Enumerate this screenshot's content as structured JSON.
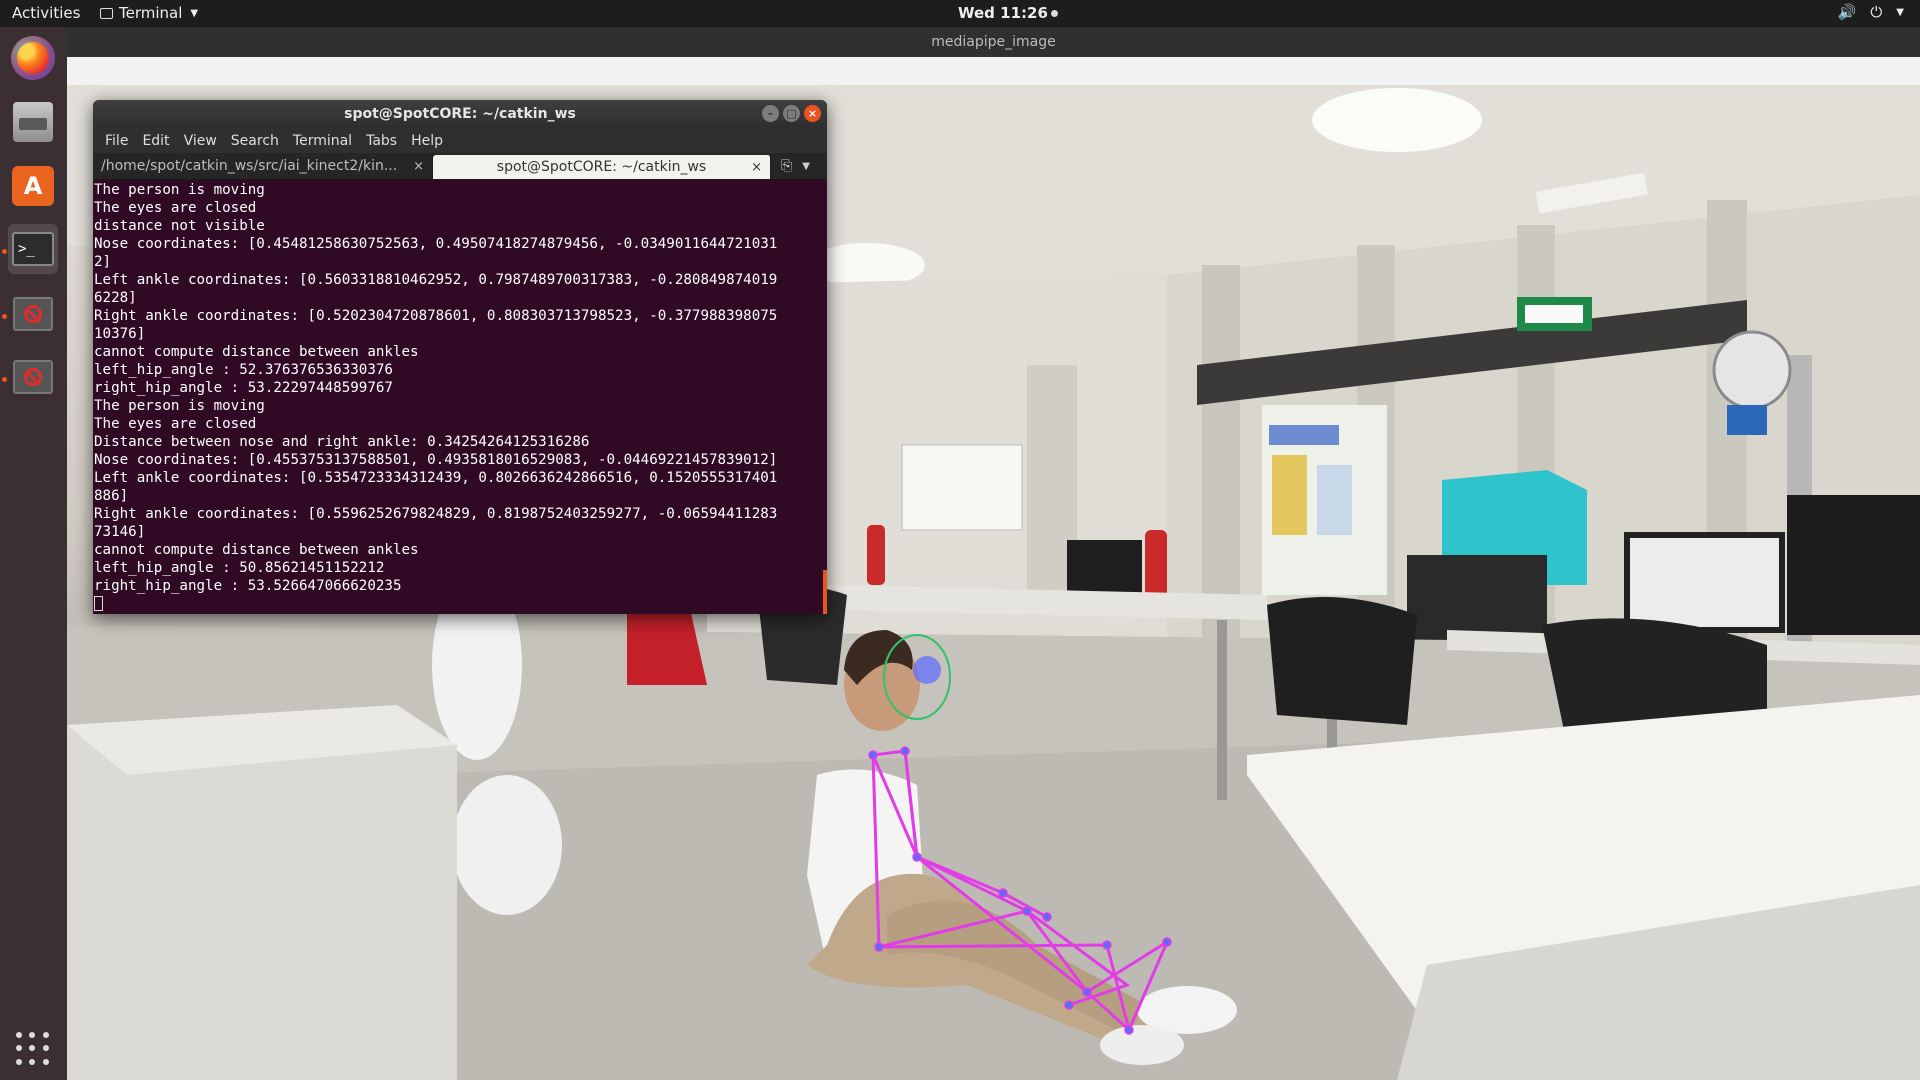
{
  "topbar": {
    "activities": "Activities",
    "app_name": "Terminal",
    "clock": "Wed 11:26"
  },
  "dock": {
    "items": [
      "firefox-icon",
      "files-icon",
      "software-center-icon",
      "terminal-icon",
      "blocked-app-icon",
      "blocked-app-icon"
    ],
    "accent_color": "#e95420"
  },
  "image_window": {
    "title": "mediapipe_image"
  },
  "terminal": {
    "title": "spot@SpotCORE: ~/catkin_ws",
    "menu": [
      "File",
      "Edit",
      "View",
      "Search",
      "Terminal",
      "Tabs",
      "Help"
    ],
    "tabs": [
      {
        "label": "/home/spot/catkin_ws/src/iai_kinect2/kin...",
        "close": "×"
      },
      {
        "label": "spot@SpotCORE: ~/catkin_ws",
        "close": "×"
      }
    ],
    "lines": [
      "The person is moving",
      "The eyes are closed",
      "distance not visible",
      "Nose coordinates: [0.45481258630752563, 0.49507418274879456, -0.0349011644721031",
      "2]",
      "Left ankle coordinates: [0.5603318810462952, 0.7987489700317383, -0.280849874019",
      "6228]",
      "Right ankle coordinates: [0.5202304720878601, 0.808303713798523, -0.377988398075",
      "10376]",
      "cannot compute distance between ankles",
      "left_hip_angle : 52.376376536330376",
      "right_hip_angle : 53.22297448599767",
      "The person is moving",
      "The eyes are closed",
      "Distance between nose and right ankle: 0.34254264125316286",
      "Nose coordinates: [0.4553753137588501, 0.4935818016529083, -0.04469221457839012]",
      "Left ankle coordinates: [0.5354723334312439, 0.8026636242866516, 0.1520555317401",
      "886]",
      "Right ankle coordinates: [0.5596252679824829, 0.8198752403259277, -0.06594411283",
      "73146]",
      "cannot compute distance between ankles",
      "left_hip_angle : 50.85621451152212",
      "right_hip_angle : 53.526647066620235"
    ],
    "background_color": "#300a24"
  },
  "scene": {
    "exit_sign_color": "#1e8a4a",
    "pose_color": "#e23ce8",
    "landmark_color": "#5b6bff",
    "face_mesh_color": "#31c26a"
  }
}
